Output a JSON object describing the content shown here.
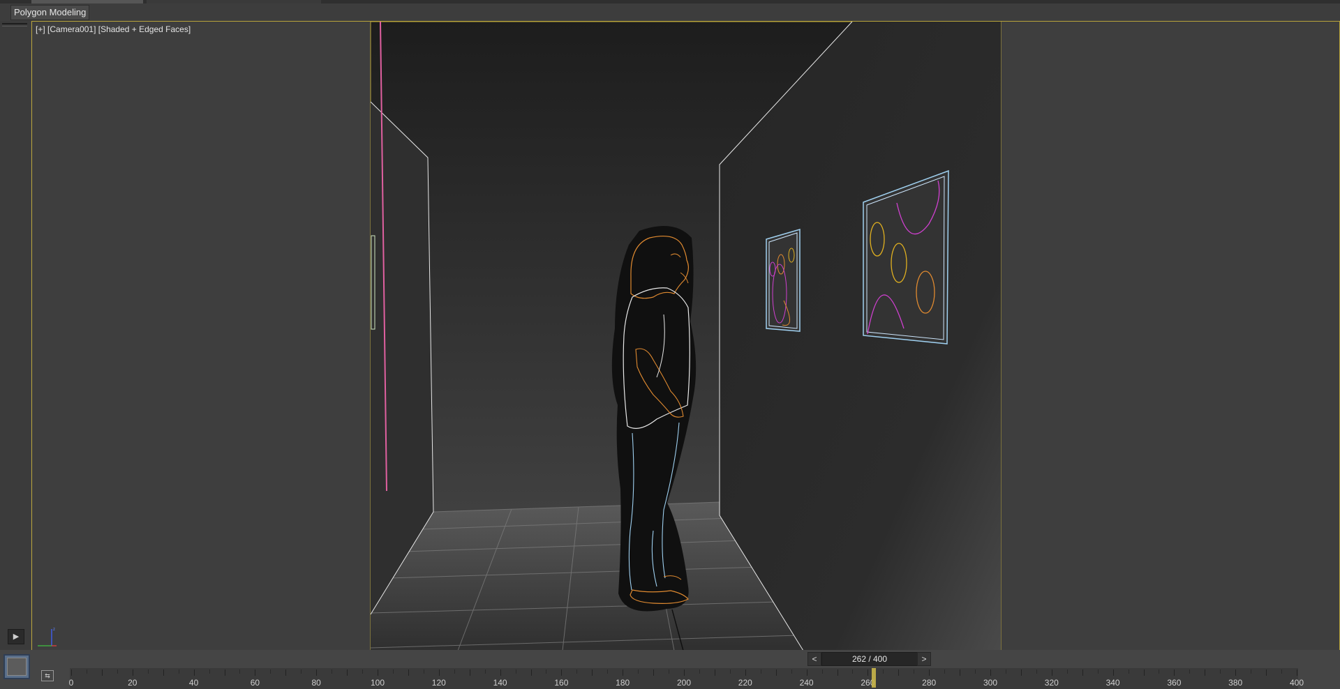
{
  "ribbon": {
    "label": "Polygon Modeling"
  },
  "viewport": {
    "label_plus": "[+]",
    "label_camera": "[Camera001]",
    "label_shading": "[Shaded + Edged Faces]",
    "border_color": "#b8a43a",
    "background_color": "#3e3e3e"
  },
  "frame_nav": {
    "prev_label": "<",
    "counter": "262 / 400",
    "next_label": ">"
  },
  "timeline": {
    "current_frame": 262,
    "total_frames": 400,
    "start": 0,
    "end": 400,
    "tick_labels": [
      "0",
      "20",
      "40",
      "60",
      "80",
      "100",
      "120",
      "140",
      "160",
      "180",
      "200",
      "220",
      "240",
      "260",
      "280",
      "300",
      "320",
      "340",
      "360",
      "380",
      "400"
    ]
  },
  "colors": {
    "accent": "#c9b64a",
    "wire_white": "#e8e8e8",
    "wire_blue": "#9fd0f0",
    "wire_orange": "#e08a30",
    "wire_magenta": "#d040d0",
    "wire_pink": "#e060a0"
  },
  "icons": {
    "play": "play-icon",
    "axis": "axis-gizmo-icon",
    "key": "set-key-icon"
  }
}
